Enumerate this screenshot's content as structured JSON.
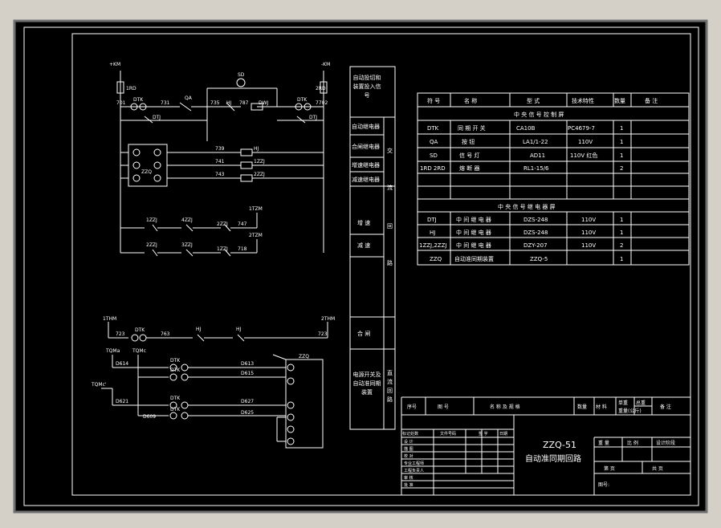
{
  "power": {
    "pos_bus": "+KM",
    "neg_bus": "-KM",
    "fuse_left": "1RD",
    "fuse_right": "2RD",
    "lamp": "SD"
  },
  "labels": {
    "n701": "701",
    "dtk_top": "DTK",
    "n731": "731",
    "qa": "QA",
    "n735": "735",
    "hj": "HJ",
    "n787": "787",
    "dwj": "DWJ",
    "dtk_right": "DTK",
    "n7702": "7702",
    "dtj_left": "DTJ",
    "dtj_right": "DTJ",
    "zzq": "ZZQ",
    "n739": "739",
    "hj2": "HJ",
    "n741": "741",
    "zzj1": "1ZZJ",
    "n743": "743",
    "zzj2": "2ZZJ",
    "t1zz": "1ZZJ",
    "t4zz": "4ZZJ",
    "t2zz": "2ZZJ",
    "n747": "747",
    "n1tzm": "1TZM",
    "b2zz": "2ZZJ",
    "b3zz": "3ZZJ",
    "b1zz": "1ZZJ",
    "n718": "718",
    "n2tzm": "2TZM",
    "n1thm": "1THM",
    "n2thm": "2THM",
    "n723": "723",
    "n723r": "723",
    "dtk_b": "DTK",
    "n763": "763",
    "hj_b1": "HJ",
    "hj_b2": "HJ",
    "thm_a": "TQMa",
    "thm_b": "TQMc",
    "thm_c": "TQMc'",
    "n614": "D614",
    "n621": "D621",
    "dtk_r1": "DTK",
    "dtk_r2": "DTK",
    "dtk_r3": "DTK",
    "dtk_r4": "DTK",
    "n613": "D613",
    "n615": "D615",
    "n627": "D627",
    "n609": "D609",
    "n625": "D625",
    "zzq_b": "ZZQ"
  },
  "sections": {
    "h_auto": "自动投切和装置投入信号",
    "h_auto_relay": "自动继电器",
    "h_close_relay": "合闸继电器",
    "h_inc_relay": "增速继电器",
    "h_dec_relay": "减速继电器",
    "h_inc": "增 速",
    "h_dec": "减 速",
    "h_close": "合 闸",
    "h_pwr": "电源开关及自动准同期装置",
    "side_ac": "交",
    "side_ac2": "流",
    "side_ac3": "回",
    "side_ac4": "路",
    "side_dc": "直流回路"
  },
  "equipment_table": {
    "headers": [
      "符 号",
      "名 称",
      "型 式",
      "技术特性",
      "数量",
      "备 注"
    ],
    "group1": "中 央 信 号 控 制 屏",
    "rows1": [
      [
        "DTK",
        "同 期 开 关",
        "CA10B",
        "PC4679-7",
        "1",
        ""
      ],
      [
        "QA",
        "按 钮",
        "LA1/1-22",
        "110V",
        "1",
        ""
      ],
      [
        "SD",
        "信 号 灯",
        "AD11",
        "110V 红色",
        "1",
        ""
      ],
      [
        "1RD 2RD",
        "熔 断 器",
        "RL1-15/6",
        "",
        "2",
        ""
      ]
    ],
    "group2": "中 央 信 号 继 电 器 屏",
    "rows2": [
      [
        "DTJ",
        "中 间 继 电 器",
        "DZS-248",
        "110V",
        "1",
        ""
      ],
      [
        "HJ",
        "中 间 继 电 器",
        "DZS-248",
        "110V",
        "1",
        ""
      ],
      [
        "1ZZJ,2ZZJ",
        "中 间 继 电 器",
        "DZY-207",
        "110V",
        "2",
        ""
      ],
      [
        "ZZQ",
        "自动准同期装置",
        "ZZQ-5",
        "",
        "1",
        ""
      ]
    ]
  },
  "title_block": {
    "h_seq": "序号",
    "h_code": "图 号",
    "h_name": "名 称 及 规 格",
    "h_qty": "数量",
    "h_mat": "材 料",
    "h_unit_w": "单重",
    "h_total_w": "总重",
    "h_weight": "重量(公斤)",
    "h_note": "备 注",
    "rev_mark": "标记处数",
    "rev_file": "文件号码",
    "rev_sign": "签 字",
    "rev_date": "日期",
    "drawing_no": "ZZQ-51",
    "drawing_title": "自动准同期回路",
    "roles": [
      "设 计",
      "描 图",
      "校 对",
      "专业工程师",
      "工程负责人",
      "审 核",
      "批 准"
    ],
    "col_weight": "重 量",
    "col_scale": "比 例",
    "col_stage": "设计阶段",
    "sheet": "第 页",
    "total": "共 页",
    "figno": "图号:"
  }
}
